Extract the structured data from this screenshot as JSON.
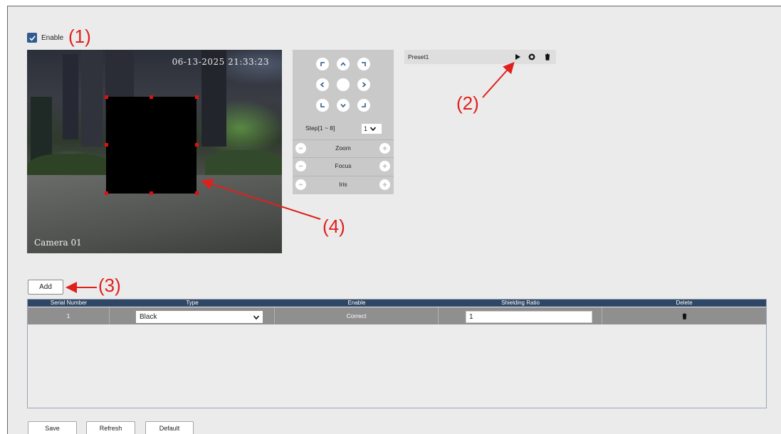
{
  "enable": {
    "label": "Enable",
    "checked": true
  },
  "annotations": {
    "a1": "(1)",
    "a2": "(2)",
    "a3": "(3)",
    "a4": "(4)"
  },
  "video": {
    "timestamp": "06-13-2025 21:33:23",
    "camera_name": "Camera  01"
  },
  "ptz": {
    "step_label": "Step[1 ~ 8]",
    "step_value": "1",
    "zoom_label": "Zoom",
    "focus_label": "Focus",
    "iris_label": "Iris"
  },
  "preset": {
    "name": "Preset1",
    "icons": [
      "play-icon",
      "gear-icon",
      "trash-icon"
    ]
  },
  "add_label": "Add",
  "table": {
    "headers": [
      "Serial Number",
      "Type",
      "Enable",
      "Shielding Ratio",
      "Delete"
    ],
    "rows": [
      {
        "serial": "1",
        "type": "Black",
        "enable": "Correct",
        "ratio": "1"
      }
    ]
  },
  "buttons": {
    "save": "Save",
    "refresh": "Refresh",
    "default": "Default"
  },
  "colors": {
    "accent": "#2f5b8f",
    "table_header": "#2f4766",
    "annotation": "#e0201c"
  }
}
